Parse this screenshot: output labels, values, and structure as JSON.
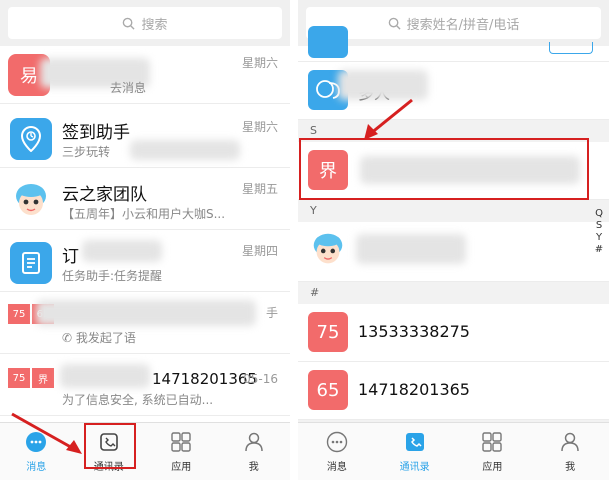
{
  "left_screen": {
    "search": {
      "placeholder": "搜索"
    },
    "chats": [
      {
        "badge": "易",
        "title": "",
        "subtitle": "",
        "subtitle_tail": "去消息",
        "time": "星期六",
        "color": "#f26b6b"
      },
      {
        "title": "签到助手",
        "subtitle": "三步玩转",
        "time": "星期六",
        "color": "#3ba7ea"
      },
      {
        "title": "云之家团队",
        "subtitle": "【五周年】小云和用户大咖S...",
        "time": "星期五",
        "color": "#5cc1ee"
      },
      {
        "title": "订",
        "subtitle": "任务助手:任务提醒",
        "time": "星期四",
        "color": "#3ba7ea"
      },
      {
        "title": "",
        "subtitle": "我发起了语",
        "time": "手",
        "badges": [
          "75",
          "65"
        ],
        "color": "#f26b6b"
      },
      {
        "title": "",
        "subtitle": "为了信息安全, 系统已自动...",
        "time": "05-16",
        "number": "14718201365",
        "badges": [
          "75",
          "界"
        ],
        "color": "#f26b6b"
      }
    ],
    "tabs": [
      {
        "label": "消息",
        "icon": "chat-bubble-icon",
        "active": true
      },
      {
        "label": "通讯录",
        "icon": "contacts-icon"
      },
      {
        "label": "应用",
        "icon": "apps-grid-icon"
      },
      {
        "label": "我",
        "icon": "person-icon"
      }
    ]
  },
  "right_screen": {
    "search": {
      "placeholder": "搜索姓名/拼音/电话"
    },
    "rows": {
      "group": {
        "name": "多人"
      },
      "section_s": "S",
      "contact_jie": {
        "avatar": "界",
        "name": ""
      },
      "section_y": "Y",
      "yun_contact": {
        "name": ""
      },
      "section_hash": "#",
      "contact_75": {
        "avatar": "75",
        "name": "13533338275"
      },
      "contact_65": {
        "avatar": "65",
        "name": "14718201365"
      }
    },
    "index_letters": [
      "Q",
      "S",
      "Y",
      "#"
    ],
    "tabs": [
      {
        "label": "消息",
        "icon": "chat-bubble-icon"
      },
      {
        "label": "通讯录",
        "icon": "contacts-icon",
        "active": true
      },
      {
        "label": "应用",
        "icon": "apps-grid-icon"
      },
      {
        "label": "我",
        "icon": "person-icon"
      }
    ]
  },
  "colors": {
    "accent": "#2aa3e8",
    "red_avatar": "#f26b6b",
    "highlight": "#d62020"
  }
}
